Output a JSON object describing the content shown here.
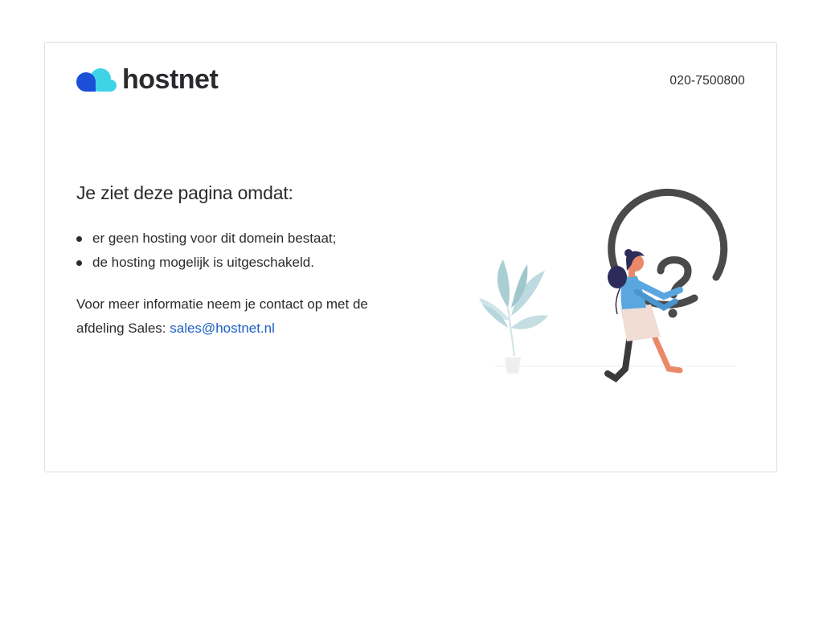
{
  "brand": {
    "name": "hostnet",
    "colors": {
      "cloud_dark": "#1b4fd8",
      "cloud_light": "#3fd3e8",
      "wordmark": "#2a2a2e"
    }
  },
  "header": {
    "phone": "020-7500800"
  },
  "main": {
    "heading": "Je ziet deze pagina omdat:",
    "reasons": [
      "er geen hosting voor dit domein bestaat;",
      "de hosting mogelijk is uitgeschakeld."
    ],
    "info_text": "Voor meer informatie neem je contact op met de afdeling Sales: ",
    "sales_email": "sales@hostnet.nl",
    "link_color": "#1b5fc4"
  },
  "illustration": {
    "icon": "question-mark-icon",
    "description_icons": [
      "plant-icon",
      "person-icon"
    ]
  }
}
